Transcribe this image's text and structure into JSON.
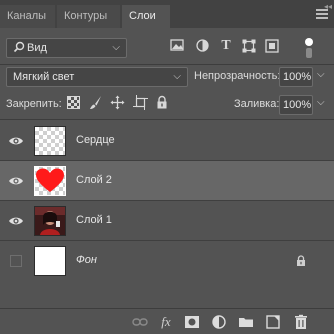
{
  "tabs": [
    {
      "label": "Каналы",
      "active": false
    },
    {
      "label": "Контуры",
      "active": false
    },
    {
      "label": "Слои",
      "active": true
    }
  ],
  "filter": {
    "label": "Вид"
  },
  "blend_mode": {
    "value": "Мягкий свет"
  },
  "opacity": {
    "label": "Непрозрачность:",
    "value": "100%"
  },
  "lock": {
    "label": "Закрепить:"
  },
  "fill": {
    "label": "Заливка:",
    "value": "100%"
  },
  "layers": [
    {
      "name": "Сердце",
      "visible": true,
      "selected": false
    },
    {
      "name": "Слой 2",
      "visible": true,
      "selected": true
    },
    {
      "name": "Слой 1",
      "visible": true,
      "selected": false
    },
    {
      "name": "Фон",
      "visible": false,
      "selected": false,
      "locked": true
    }
  ],
  "colors": {
    "panel": "#535353",
    "selected_row": "#676767",
    "heart": "#ff1a1a"
  }
}
